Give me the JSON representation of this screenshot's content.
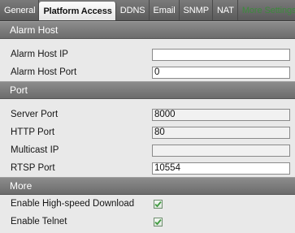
{
  "tabs": [
    {
      "label": "General",
      "active": false
    },
    {
      "label": "Platform Access",
      "active": true
    },
    {
      "label": "DDNS",
      "active": false
    },
    {
      "label": "Email",
      "active": false
    },
    {
      "label": "SNMP",
      "active": false
    },
    {
      "label": "NAT",
      "active": false
    },
    {
      "label": "More Settings",
      "active": false
    }
  ],
  "alarm_host": {
    "header": "Alarm Host",
    "ip_label": "Alarm Host IP",
    "ip_value": "",
    "port_label": "Alarm Host Port",
    "port_value": "0"
  },
  "port": {
    "header": "Port",
    "server_port_label": "Server Port",
    "server_port_value": "8000",
    "http_port_label": "HTTP Port",
    "http_port_value": "80",
    "multicast_ip_label": "Multicast IP",
    "multicast_ip_value": "",
    "rtsp_port_label": "RTSP Port",
    "rtsp_port_value": "10554"
  },
  "more": {
    "header": "More",
    "high_speed_download_label": "Enable High-speed Download",
    "high_speed_download_checked": true,
    "telnet_label": "Enable Telnet",
    "telnet_checked": true
  },
  "colors": {
    "check_mark": "#3f9a3f",
    "faded_tab_text": "#3c8a3c"
  },
  "icons": {
    "checkbox_checked": "check-icon"
  }
}
